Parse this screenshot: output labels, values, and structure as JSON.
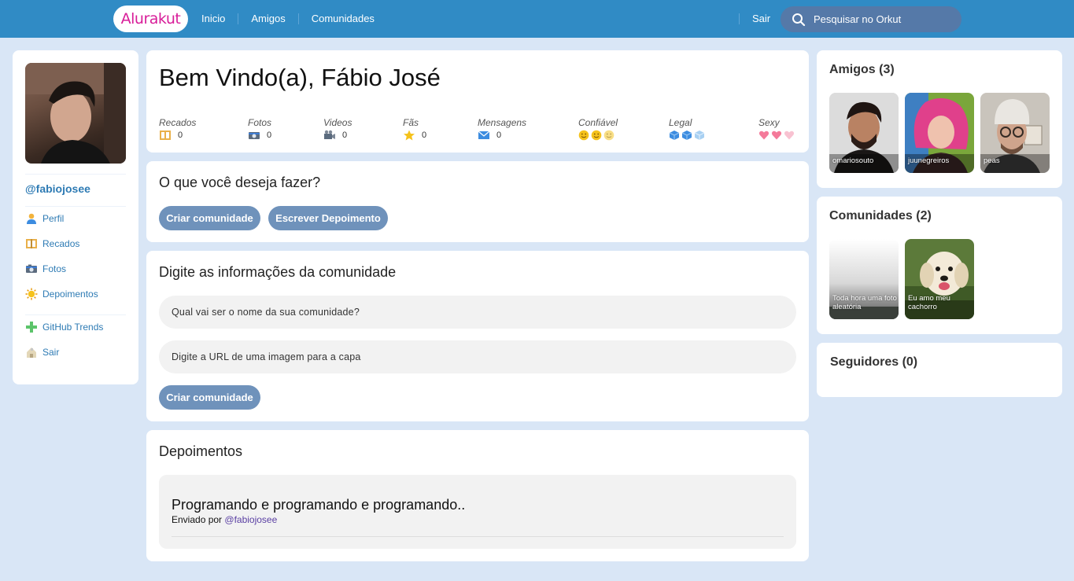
{
  "header": {
    "logo": "Alurakut",
    "nav": [
      "Inicio",
      "Amigos",
      "Comunidades"
    ],
    "logout": "Sair",
    "search_placeholder": "Pesquisar no Orkut"
  },
  "sidebar": {
    "username": "@fabiojosee",
    "menu": [
      {
        "label": "Perfil",
        "icon": "user-icon"
      },
      {
        "label": "Recados",
        "icon": "book-icon"
      },
      {
        "label": "Fotos",
        "icon": "camera-icon"
      },
      {
        "label": "Depoimentos",
        "icon": "sun-icon"
      },
      {
        "label": "GitHub Trends",
        "icon": "plus-icon"
      },
      {
        "label": "Sair",
        "icon": "logout-icon"
      }
    ]
  },
  "welcome": {
    "title": "Bem Vindo(a), Fábio José",
    "stats": [
      {
        "label": "Recados",
        "value": "0",
        "icon": "book-icon"
      },
      {
        "label": "Fotos",
        "value": "0",
        "icon": "camera-icon"
      },
      {
        "label": "Videos",
        "value": "0",
        "icon": "video-camera-icon"
      },
      {
        "label": "Fãs",
        "value": "0",
        "icon": "star-icon"
      },
      {
        "label": "Mensagens",
        "value": "0",
        "icon": "envelope-icon"
      }
    ],
    "ratings": [
      {
        "label": "Confiável",
        "icon": "smiley-icon",
        "filled": 2,
        "total": 3
      },
      {
        "label": "Legal",
        "icon": "ice-cube-icon",
        "filled": 2,
        "total": 3
      },
      {
        "label": "Sexy",
        "icon": "heart-icon",
        "filled": 2,
        "total": 3
      }
    ]
  },
  "actions": {
    "title": "O que você deseja fazer?",
    "buttons": [
      "Criar comunidade",
      "Escrever Depoimento"
    ]
  },
  "form": {
    "title": "Digite as informações da comunidade",
    "name_placeholder": "Qual vai ser o nome da sua comunidade?",
    "image_placeholder": "Digite a URL de uma imagem para a capa",
    "submit": "Criar comunidade"
  },
  "testimonials": {
    "title": "Depoimentos",
    "items": [
      {
        "text": "Programando e programando e programando..",
        "by_prefix": "Enviado por",
        "author": "@fabiojosee"
      }
    ]
  },
  "friends": {
    "title": "Amigos (3)",
    "items": [
      "omariosouto",
      "juunegreiros",
      "peas"
    ]
  },
  "communities": {
    "title": "Comunidades (2)",
    "items": [
      "Toda hora uma foto aleatória",
      "Eu amo meu cachorro"
    ]
  },
  "followers": {
    "title": "Seguidores (0)"
  },
  "colors": {
    "topbar": "#308BC5",
    "background": "#D9E6F6",
    "link": "#2E7BB4",
    "button": "#6F92BB",
    "logo": "#D81D99"
  }
}
